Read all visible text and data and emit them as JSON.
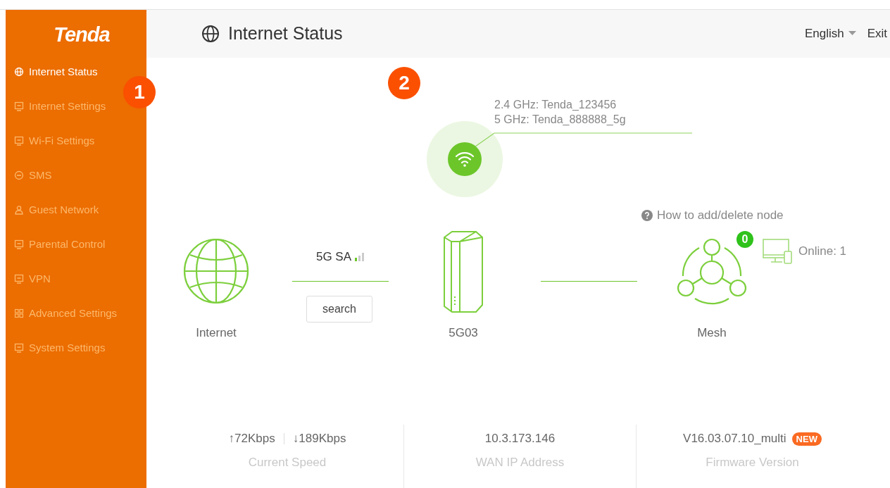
{
  "logo": "Tenda",
  "sidebar": {
    "items": [
      {
        "label": "Internet Status",
        "selected": true
      },
      {
        "label": "Internet Settings",
        "selected": false
      },
      {
        "label": "Wi-Fi Settings",
        "selected": false
      },
      {
        "label": "SMS",
        "selected": false
      },
      {
        "label": "Guest Network",
        "selected": false
      },
      {
        "label": "Parental Control",
        "selected": false
      },
      {
        "label": "VPN",
        "selected": false
      },
      {
        "label": "Advanced Settings",
        "selected": false
      },
      {
        "label": "System Settings",
        "selected": false
      }
    ]
  },
  "header": {
    "title": "Internet Status",
    "language": "English",
    "exit": "Exit"
  },
  "callouts": [
    "1",
    "2"
  ],
  "wifi": {
    "ssids": [
      "2.4 GHz: Tenda_123456",
      "5 GHz: Tenda_888888_5g"
    ]
  },
  "nodes": [
    {
      "kind": "internet",
      "label": "Internet"
    },
    {
      "kind": "router",
      "label": "5G03"
    },
    {
      "kind": "mesh",
      "label": "Mesh"
    }
  ],
  "link": {
    "network": "5G SA",
    "button": "search"
  },
  "mesh": {
    "help": "How to add/delete node",
    "count": "0",
    "online": "Online: 1"
  },
  "stats": [
    {
      "kind": "speed",
      "up": "↑72Kbps",
      "down": "↓189Kbps",
      "label": "Current Speed"
    },
    {
      "kind": "plain",
      "value": "10.3.173.146",
      "label": "WAN IP Address"
    },
    {
      "kind": "firmware",
      "value": "V16.03.07.10_multi",
      "badge": "NEW",
      "label": "Firmware Version"
    }
  ]
}
